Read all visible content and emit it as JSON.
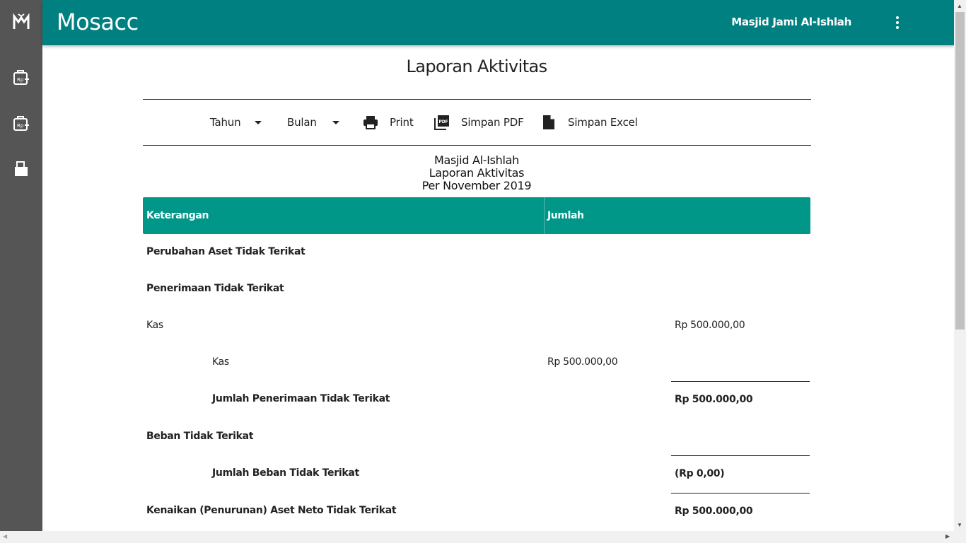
{
  "app": {
    "brand": "Mosacc",
    "org_name": "Masjid Jami Al-Ishlah"
  },
  "sidebar": {
    "items": [
      {
        "icon": "logo-icon"
      },
      {
        "icon": "cash-in-icon"
      },
      {
        "icon": "cash-out-icon"
      },
      {
        "icon": "report-icon"
      }
    ]
  },
  "page": {
    "title": "Laporan Aktivitas"
  },
  "toolbar": {
    "year_label": "Tahun",
    "month_label": "Bulan",
    "print_label": "Print",
    "pdf_label": "Simpan PDF",
    "excel_label": "Simpan Excel"
  },
  "report": {
    "org": "Masjid Al-Ishlah",
    "title": "Laporan Aktivitas",
    "period": "Per November 2019"
  },
  "table": {
    "headers": [
      "Keterangan",
      "Jumlah"
    ],
    "rows": [
      {
        "label": "Perubahan Aset Tidak Terikat"
      },
      {
        "label": "Penerimaan Tidak Terikat"
      },
      {
        "label": "Kas",
        "total": "Rp 500.000,00"
      },
      {
        "label": "Kas",
        "amount": "Rp 500.000,00"
      },
      {
        "label": "Jumlah Penerimaan Tidak Terikat",
        "total": "Rp 500.000,00"
      },
      {
        "label": "Beban Tidak Terikat"
      },
      {
        "label": "Jumlah Beban Tidak Terikat",
        "total": "(Rp 0,00)"
      },
      {
        "label": "Kenaikan (Penurunan) Aset Neto Tidak Terikat",
        "total": "Rp 500.000,00"
      }
    ]
  },
  "colors": {
    "appbar": "#008080",
    "table_header": "#009688",
    "sidebar": "#555555"
  }
}
